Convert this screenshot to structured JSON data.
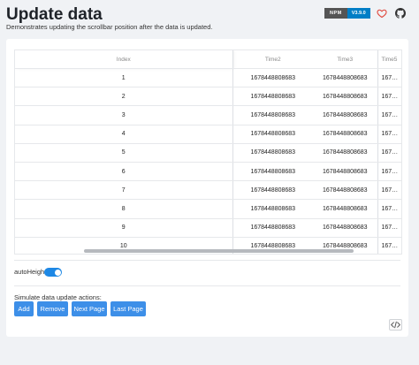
{
  "header": {
    "title": "Update data",
    "description": "Demonstrates updating the scrollbar position after the data is updated.",
    "npm_label": "NPM",
    "npm_version": "V3.9.0"
  },
  "table": {
    "columns": [
      "Index",
      "Time2",
      "Time3",
      "Time5"
    ],
    "rows": [
      [
        "1",
        "1678448808683",
        "1678448808683",
        "167…"
      ],
      [
        "2",
        "1678448808683",
        "1678448808683",
        "167…"
      ],
      [
        "3",
        "1678448808683",
        "1678448808683",
        "167…"
      ],
      [
        "4",
        "1678448808683",
        "1678448808683",
        "167…"
      ],
      [
        "5",
        "1678448808683",
        "1678448808683",
        "167…"
      ],
      [
        "6",
        "1678448808683",
        "1678448808683",
        "167…"
      ],
      [
        "7",
        "1678448808683",
        "1678448808683",
        "167…"
      ],
      [
        "8",
        "1678448808683",
        "1678448808683",
        "167…"
      ],
      [
        "9",
        "1678448808683",
        "1678448808683",
        "167…"
      ],
      [
        "10",
        "1678448808683",
        "1678448808683",
        "167…"
      ]
    ]
  },
  "controls": {
    "autoheight_label": "autoHeight:",
    "autoheight_on": true,
    "simulate_label": "Simulate data update actions:",
    "add_label": "Add",
    "remove_label": "Remove",
    "next_page_label": "Next Page",
    "last_page_label": "Last Page"
  },
  "colors": {
    "accent": "#3d8fe8",
    "toggle": "#1e88e5",
    "heart": "#e0453a"
  },
  "icons": {
    "heart": "heart-icon",
    "github": "github-icon",
    "code": "code-icon"
  }
}
